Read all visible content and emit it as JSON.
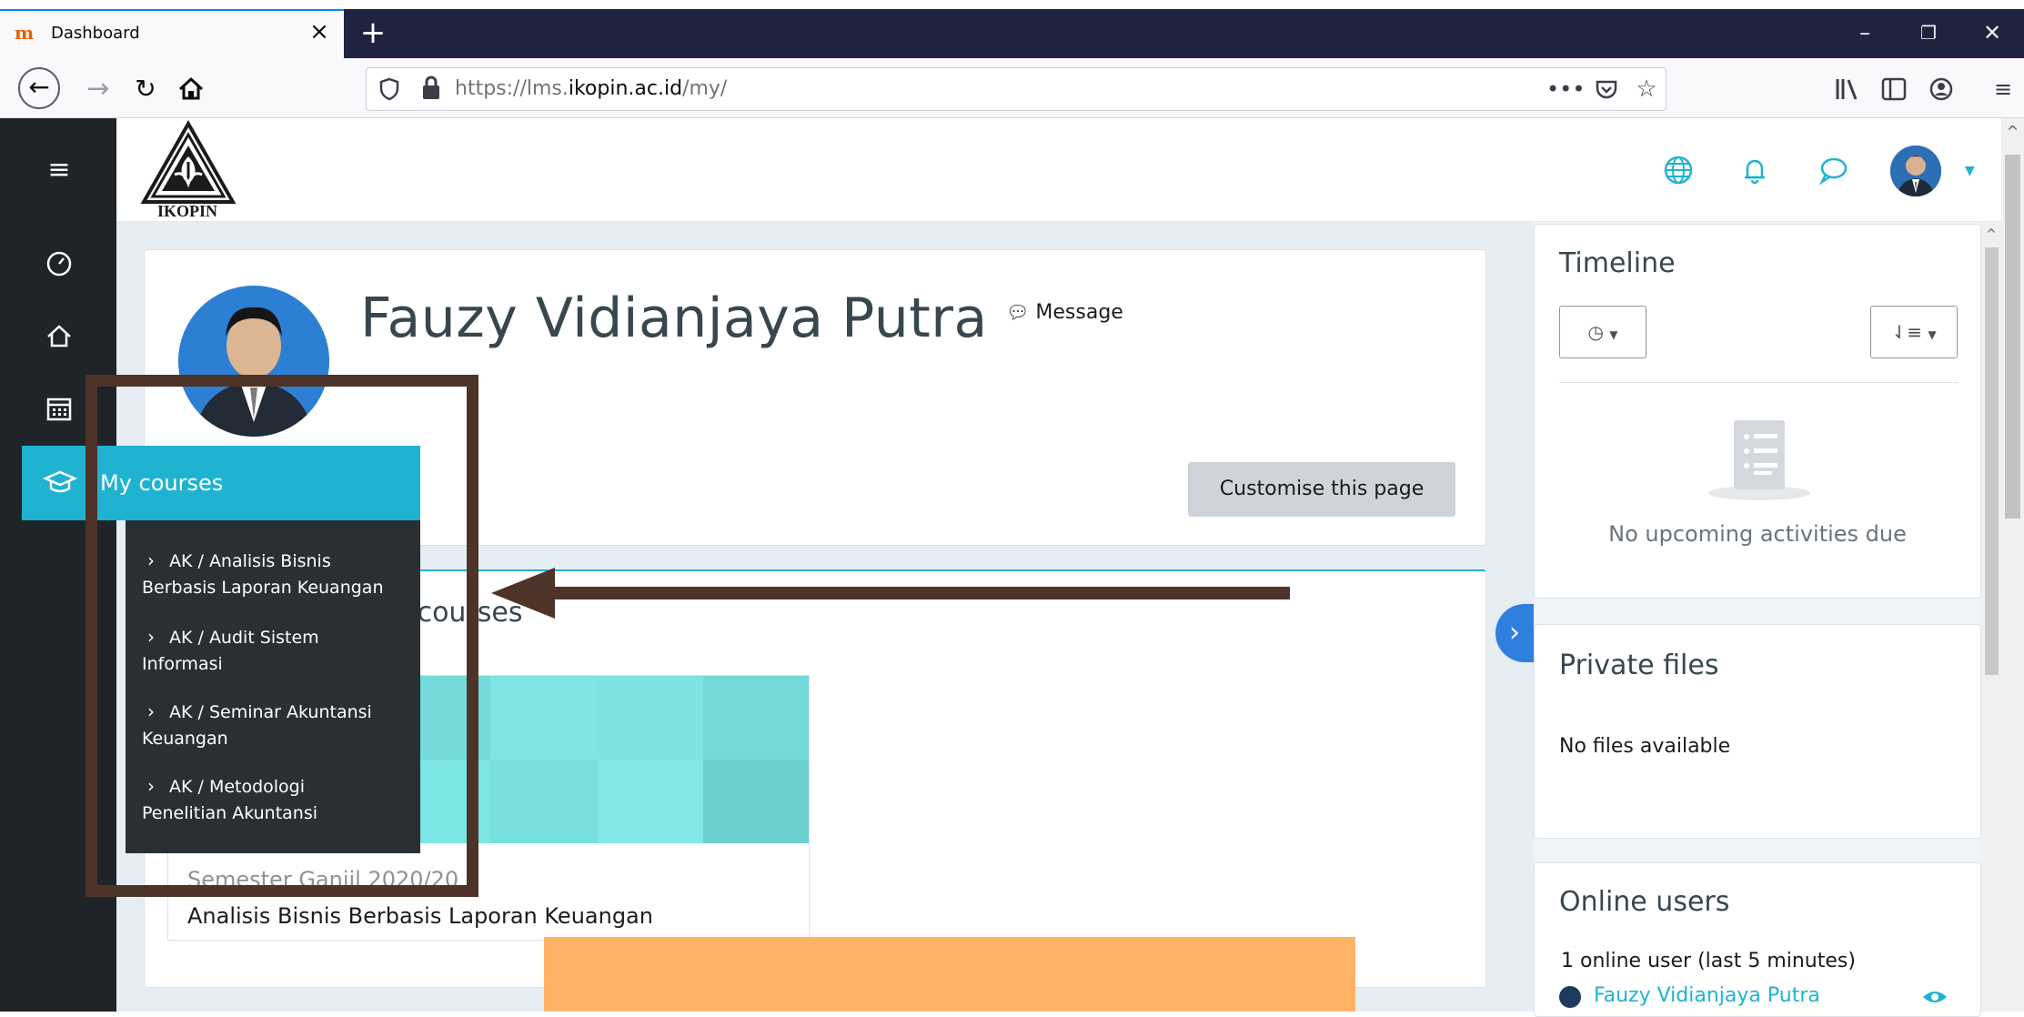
{
  "browser": {
    "tab_title": "Dashboard",
    "tab_icon": "moodle-logo-icon",
    "url_prefix": "https://lms.",
    "url_domain": "ikopin.ac.id",
    "url_path": "/my/"
  },
  "header": {
    "logo_text": "IKOPIN"
  },
  "profile": {
    "name": "Fauzy Vidianjaya Putra",
    "message_label": "Message",
    "customise_label": "Customise this page"
  },
  "recent_courses": {
    "title_visible": "d courses",
    "course_semester": "Semester Ganjil 2020/20",
    "course_name": "Analisis Bisnis Berbasis Laporan Keuangan"
  },
  "nav_drawer": {
    "my_courses_label": "My courses",
    "courses": [
      {
        "line1": "AK / Analisis Bisnis",
        "line2": "Berbasis Laporan Keuangan"
      },
      {
        "line1": "AK / Audit Sistem",
        "line2": "Informasi"
      },
      {
        "line1": "AK / Seminar Akuntansi",
        "line2": "Keuangan"
      },
      {
        "line1": "AK / Metodologi",
        "line2": "Penelitian Akuntansi"
      }
    ]
  },
  "timeline": {
    "title": "Timeline",
    "empty_text": "No upcoming activities due"
  },
  "private_files": {
    "title": "Private files",
    "empty_text": "No files available"
  },
  "online_users": {
    "title": "Online users",
    "count_text": "1 online user (last 5 minutes)",
    "user_name": "Fauzy Vidianjaya Putra"
  },
  "colors": {
    "accent": "#1fb3d1",
    "drawer": "#1f2428",
    "annotation_box": "#4e3329",
    "annotation_highlight": "#ffb366"
  }
}
